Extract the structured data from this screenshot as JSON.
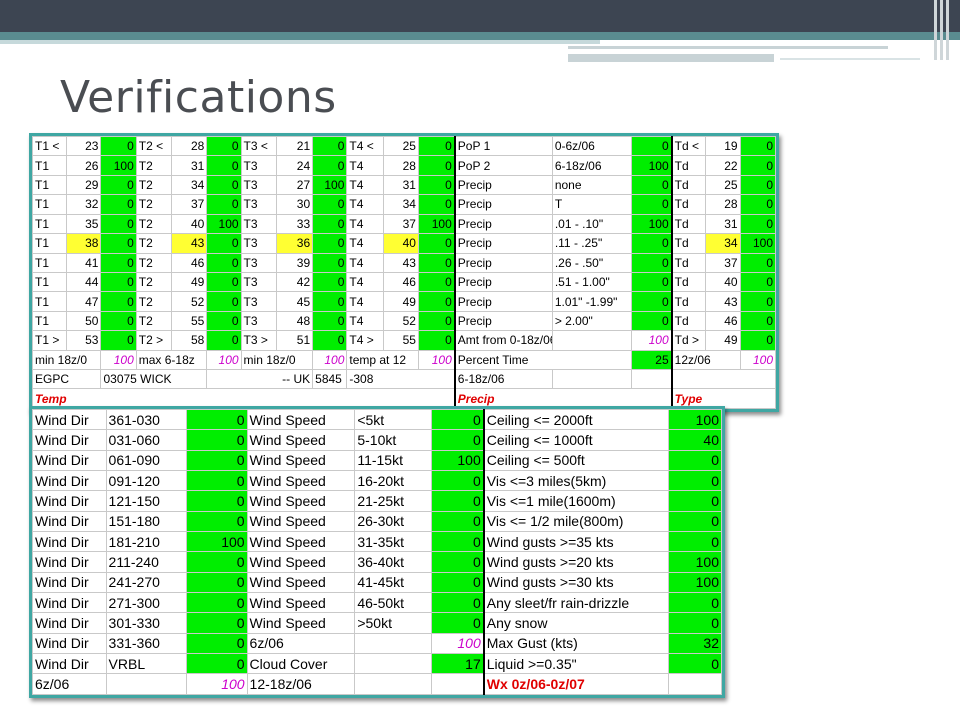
{
  "slide": {
    "title": "Verifications"
  },
  "top_table": {
    "temp_groups": [
      {
        "rows": [
          [
            "T1 <",
            "23",
            "0"
          ],
          [
            "T1",
            "26",
            "100"
          ],
          [
            "T1",
            "29",
            "0"
          ],
          [
            "T1",
            "32",
            "0"
          ],
          [
            "T1",
            "35",
            "0"
          ],
          [
            "T1",
            "38",
            "0"
          ],
          [
            "T1",
            "41",
            "0"
          ],
          [
            "T1",
            "44",
            "0"
          ],
          [
            "T1",
            "47",
            "0"
          ],
          [
            "T1",
            "50",
            "0"
          ],
          [
            "T1 >",
            "53",
            "0"
          ]
        ],
        "highlight_row": 5
      },
      {
        "rows": [
          [
            "T2 <",
            "28",
            "0"
          ],
          [
            "T2",
            "31",
            "0"
          ],
          [
            "T2",
            "34",
            "0"
          ],
          [
            "T2",
            "37",
            "0"
          ],
          [
            "T2",
            "40",
            "100"
          ],
          [
            "T2",
            "43",
            "0"
          ],
          [
            "T2",
            "46",
            "0"
          ],
          [
            "T2",
            "49",
            "0"
          ],
          [
            "T2",
            "52",
            "0"
          ],
          [
            "T2",
            "55",
            "0"
          ],
          [
            "T2 >",
            "58",
            "0"
          ]
        ],
        "highlight_row": 5
      },
      {
        "rows": [
          [
            "T3 <",
            "21",
            "0"
          ],
          [
            "T3",
            "24",
            "0"
          ],
          [
            "T3",
            "27",
            "100"
          ],
          [
            "T3",
            "30",
            "0"
          ],
          [
            "T3",
            "33",
            "0"
          ],
          [
            "T3",
            "36",
            "0"
          ],
          [
            "T3",
            "39",
            "0"
          ],
          [
            "T3",
            "42",
            "0"
          ],
          [
            "T3",
            "45",
            "0"
          ],
          [
            "T3",
            "48",
            "0"
          ],
          [
            "T3 >",
            "51",
            "0"
          ]
        ],
        "highlight_row": 5
      },
      {
        "rows": [
          [
            "T4 <",
            "25",
            "0"
          ],
          [
            "T4",
            "28",
            "0"
          ],
          [
            "T4",
            "31",
            "0"
          ],
          [
            "T4",
            "34",
            "0"
          ],
          [
            "T4",
            "37",
            "100"
          ],
          [
            "T4",
            "40",
            "0"
          ],
          [
            "T4",
            "43",
            "0"
          ],
          [
            "T4",
            "46",
            "0"
          ],
          [
            "T4",
            "49",
            "0"
          ],
          [
            "T4",
            "52",
            "0"
          ],
          [
            "T4 >",
            "55",
            "0"
          ]
        ],
        "highlight_row": 5
      }
    ],
    "precip_rows": [
      [
        "PoP 1",
        "0-6z/06",
        "0"
      ],
      [
        "PoP 2",
        "6-18z/06",
        "100"
      ],
      [
        "Precip",
        "none",
        "0"
      ],
      [
        "Precip",
        "T",
        "0"
      ],
      [
        "Precip",
        ".01 - .10\"",
        "100"
      ],
      [
        "Precip",
        ".11 - .25\"",
        "0"
      ],
      [
        "Precip",
        ".26 - .50\"",
        "0"
      ],
      [
        "Precip",
        ".51 - 1.00\"",
        "0"
      ],
      [
        "Precip",
        "1.01\" -1.99\"",
        "0"
      ],
      [
        "Precip",
        "> 2.00\"",
        "0"
      ],
      [
        "Amt from 0-18z/06",
        "",
        "100"
      ]
    ],
    "td_rows": [
      [
        "Td <",
        "19",
        "0"
      ],
      [
        "Td",
        "22",
        "0"
      ],
      [
        "Td",
        "25",
        "0"
      ],
      [
        "Td",
        "28",
        "0"
      ],
      [
        "Td",
        "31",
        "0"
      ],
      [
        "Td",
        "34",
        "100"
      ],
      [
        "Td",
        "37",
        "0"
      ],
      [
        "Td",
        "40",
        "0"
      ],
      [
        "Td",
        "43",
        "0"
      ],
      [
        "Td",
        "46",
        "0"
      ],
      [
        "Td >",
        "49",
        "0"
      ]
    ],
    "summary_row": {
      "t1_label": "min 18z/0",
      "t1_value": "100",
      "t2_label": "max 6-18z",
      "t2_value": "100",
      "t3_label": "min 18z/0",
      "t3_value": "100",
      "t4_label": "temp at 12",
      "t4_value": "100",
      "precip_label": "Percent Time",
      "precip_value": "25",
      "td_label": "12z/06",
      "td_value": "100"
    },
    "station_row": {
      "code": "EGPC",
      "number": "03075 WICK",
      "country": "-- UK",
      "elevation": "5845",
      "offset": "-308",
      "precip_period": "6-18z/06"
    },
    "footer_labels": {
      "temp": "Temp",
      "precip": "Precip",
      "type": "Type"
    }
  },
  "bottom_table": {
    "wind_dir_rows": [
      [
        "Wind Dir",
        "361-030",
        "0"
      ],
      [
        "Wind Dir",
        "031-060",
        "0"
      ],
      [
        "Wind Dir",
        "061-090",
        "0"
      ],
      [
        "Wind Dir",
        "091-120",
        "0"
      ],
      [
        "Wind Dir",
        "121-150",
        "0"
      ],
      [
        "Wind Dir",
        "151-180",
        "0"
      ],
      [
        "Wind Dir",
        "181-210",
        "100"
      ],
      [
        "Wind Dir",
        "211-240",
        "0"
      ],
      [
        "Wind Dir",
        "241-270",
        "0"
      ],
      [
        "Wind Dir",
        "271-300",
        "0"
      ],
      [
        "Wind Dir",
        "301-330",
        "0"
      ],
      [
        "Wind Dir",
        "331-360",
        "0"
      ],
      [
        "Wind Dir",
        "VRBL",
        "0"
      ]
    ],
    "wind_speed_rows": [
      [
        "Wind Speed",
        "<5kt",
        "0"
      ],
      [
        "Wind Speed",
        "5-10kt",
        "0"
      ],
      [
        "Wind Speed",
        "11-15kt",
        "100"
      ],
      [
        "Wind Speed",
        "16-20kt",
        "0"
      ],
      [
        "Wind Speed",
        "21-25kt",
        "0"
      ],
      [
        "Wind Speed",
        "26-30kt",
        "0"
      ],
      [
        "Wind Speed",
        "31-35kt",
        "0"
      ],
      [
        "Wind Speed",
        "36-40kt",
        "0"
      ],
      [
        "Wind Speed",
        "41-45kt",
        "0"
      ],
      [
        "Wind Speed",
        "46-50kt",
        "0"
      ],
      [
        "Wind Speed",
        ">50kt",
        "0"
      ]
    ],
    "wind_speed_period": {
      "label": "6z/06",
      "value": "100"
    },
    "cloud_cover": {
      "label": "Cloud Cover",
      "value": "17"
    },
    "cloud_period": "12-18z/06",
    "weather_rows": [
      [
        "Ceiling <= 2000ft",
        "100"
      ],
      [
        "Ceiling <= 1000ft",
        "40"
      ],
      [
        "Ceiling <= 500ft",
        "0"
      ],
      [
        "Vis <=3 miles(5km)",
        "0"
      ],
      [
        "Vis <=1 mile(1600m)",
        "0"
      ],
      [
        "Vis <= 1/2 mile(800m)",
        "0"
      ],
      [
        "Wind gusts >=35 kts",
        "0"
      ],
      [
        "Wind gusts >=20 kts",
        "100"
      ],
      [
        "Wind gusts >=30 kts",
        "100"
      ],
      [
        "Any sleet/fr rain-drizzle",
        "0"
      ],
      [
        "Any snow",
        "0"
      ],
      [
        "Max Gust (kts)",
        "32"
      ],
      [
        "Liquid >=0.35\"",
        "0"
      ]
    ],
    "wx_label": "Wx 0z/06-0z/07",
    "wind_dir_period": {
      "label": "6z/06",
      "value": "100"
    }
  },
  "colors": {
    "accent_teal": "#3fa7a3",
    "cell_green": "#00ee00",
    "cell_yellow": "#ffff33",
    "magenta_text": "#cc00cc",
    "red_text": "#e00000",
    "top_bar": "#3d4552"
  }
}
